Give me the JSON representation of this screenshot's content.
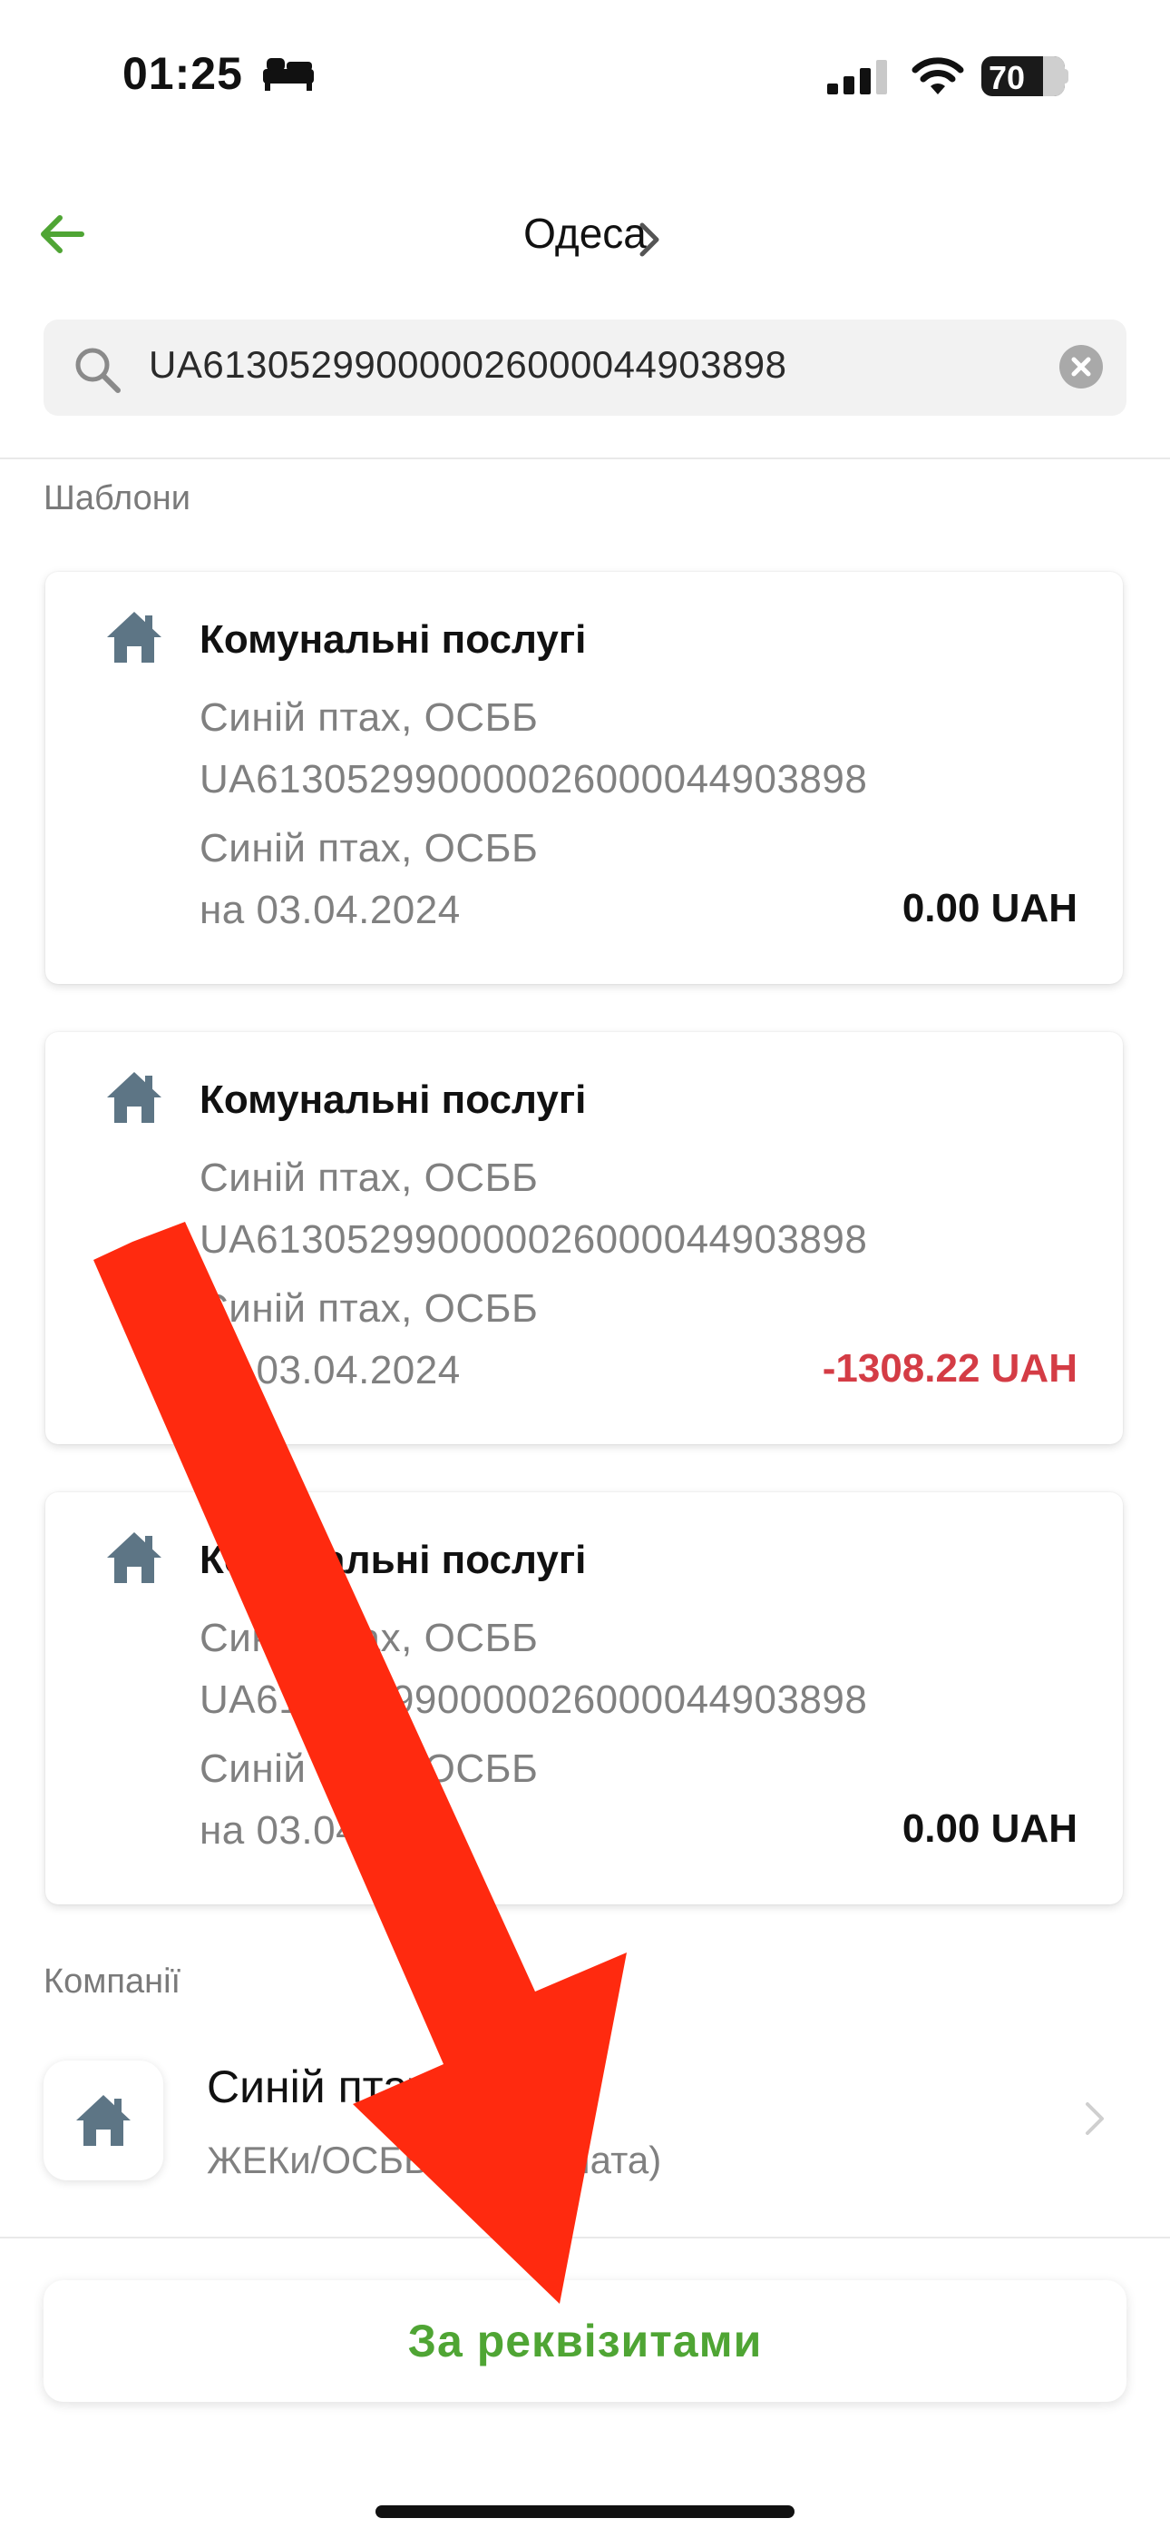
{
  "status_bar": {
    "time": "01:25",
    "battery": "70"
  },
  "header": {
    "city": "Одеса"
  },
  "search": {
    "value": "UA613052990000026000044903898"
  },
  "sections": {
    "templates": "Шаблони",
    "companies": "Компанії"
  },
  "templates": [
    {
      "title": "Комунальні послугі",
      "recipient": "Синій птах, ОСББ",
      "iban": "UA613052990000026000044903898",
      "payer": "Синій птах, ОСББ",
      "date": "на 03.04.2024",
      "amount": "0.00 UAH"
    },
    {
      "title": "Комунальні послугі",
      "recipient": "Синій птах, ОСББ",
      "iban": "UA613052990000026000044903898",
      "payer": "Синій птах, ОСББ",
      "date": "на 03.04.2024",
      "amount": "-1308.22 UAH"
    },
    {
      "title": "Комунальні послугі",
      "recipient": "Синій птах, ОСББ",
      "iban": "UA613052990000026000044903898",
      "payer": "Синій птах, ОСББ",
      "date": "на 03.04.2024",
      "amount": "0.00 UAH"
    }
  ],
  "company": {
    "name": "Синій птах, ОСББ",
    "category": "ЖЕКи/ОСББ (квартплата)"
  },
  "button": {
    "label": "За реквізитами"
  },
  "colors": {
    "accent": "#4fa534",
    "negative": "#d43c45",
    "annotation_arrow": "#ff2a0f",
    "icon": "#5d7585"
  },
  "icons": [
    "bed-icon",
    "signal-icon",
    "wifi-icon",
    "back-arrow-icon",
    "chevron-right-icon",
    "search-icon",
    "clear-icon",
    "house-icon"
  ]
}
